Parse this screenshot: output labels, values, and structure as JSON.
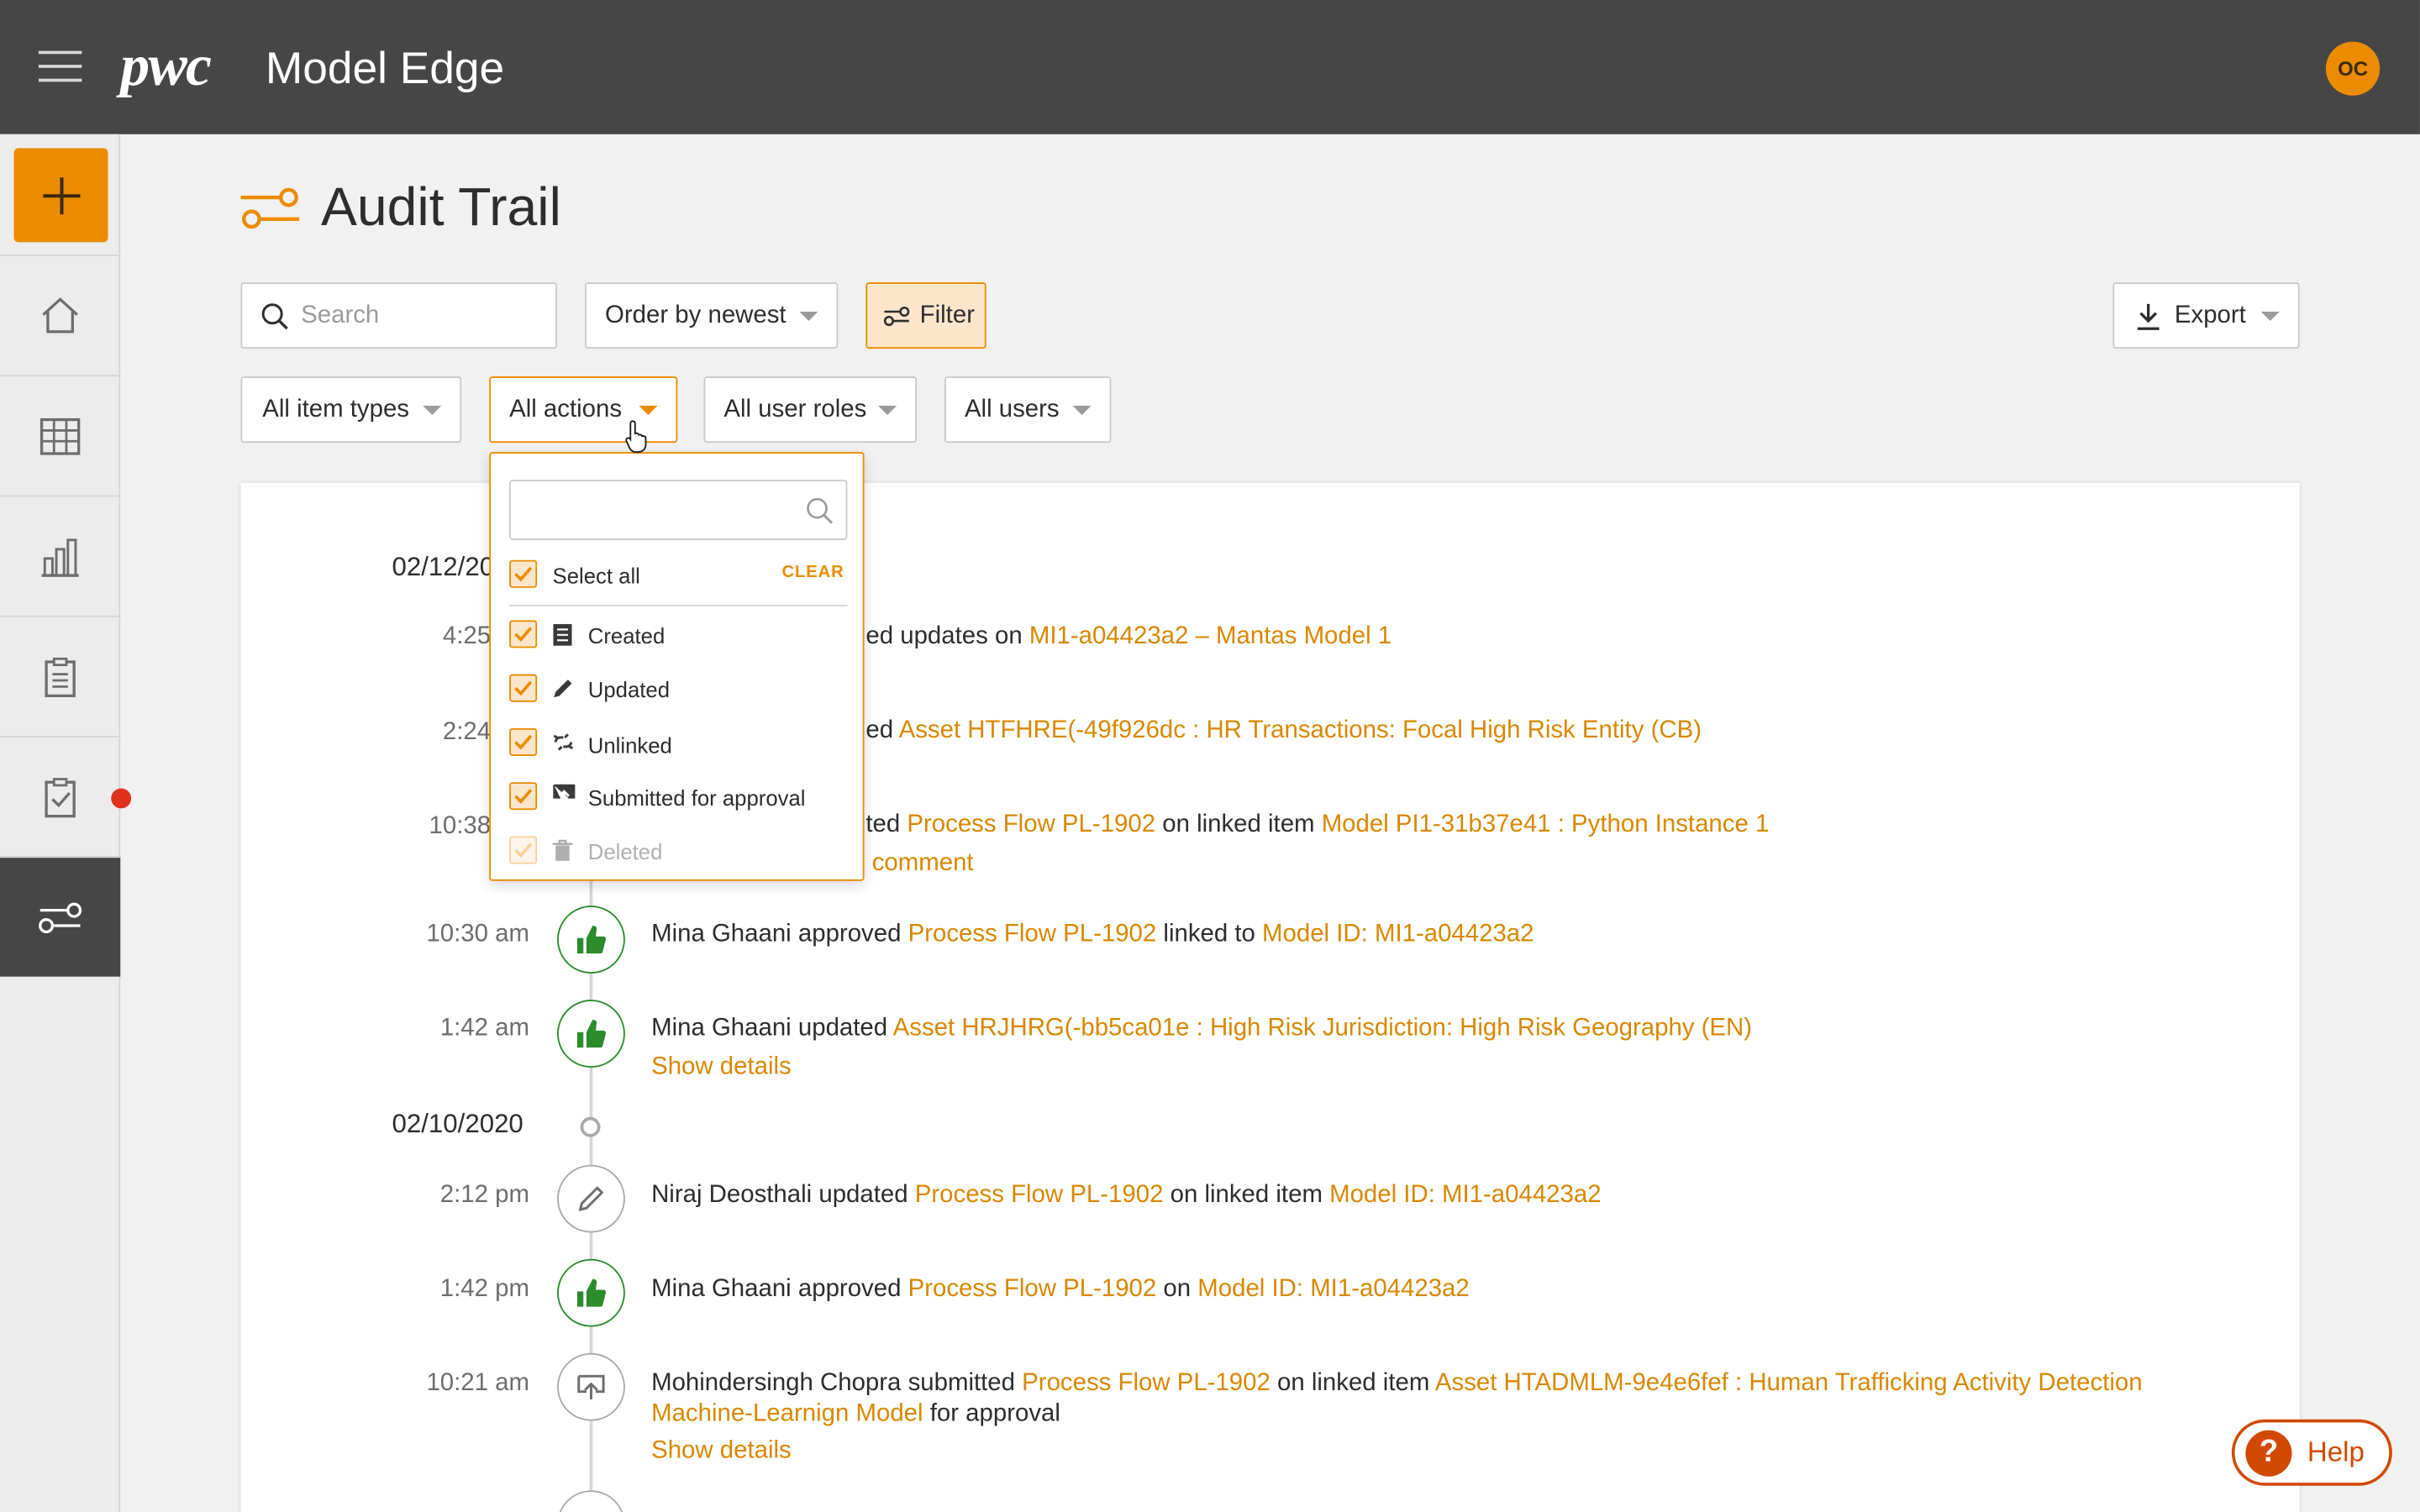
{
  "header": {
    "logo": "pwc",
    "product": "Model Edge",
    "avatar_initials": "OC"
  },
  "sidebar": {
    "items": [
      "add-icon",
      "home-icon",
      "table-icon",
      "bar-chart-icon",
      "clipboard-icon",
      "clipboard-check-icon",
      "audit-trail-icon"
    ]
  },
  "page": {
    "title": "Audit Trail"
  },
  "toolbar": {
    "search_placeholder": "Search",
    "order_label": "Order by newest",
    "filter_label": "Filter",
    "export_label": "Export"
  },
  "filters": {
    "item_types": "All item types",
    "actions": "All actions",
    "user_roles": "All user roles",
    "users": "All users"
  },
  "actions_dropdown": {
    "select_all": "Select all",
    "clear": "CLEAR",
    "options": [
      "Created",
      "Updated",
      "Unlinked",
      "Submitted for approval",
      "Deleted"
    ]
  },
  "timeline": {
    "groups": [
      {
        "date": "02/12/20",
        "entries": [
          {
            "time": "4:25",
            "text_parts": [
              "ed updates on ",
              "MI1-a04423a2 – Mantas Model 1"
            ]
          },
          {
            "time": "2:24",
            "text_parts": [
              "ed ",
              "Asset HTFHRE(-49f926dc : HR Transactions: Focal High Risk Entity (CB)"
            ]
          },
          {
            "time": "10:38",
            "text_parts": [
              "ted ",
              "Process Flow PL-1902",
              " on linked item ",
              "Model PI1-31b37e41 : Python Instance 1"
            ],
            "sub": "comment"
          },
          {
            "time": "10:30 am",
            "user": "Mina Ghaani",
            "verb": "approved",
            "text_parts": [
              "Process Flow PL-1902",
              " linked to ",
              "Model ID: MI1-a04423a2"
            ]
          },
          {
            "time": "1:42 am",
            "user": "Mina Ghaani",
            "verb": "updated",
            "text_parts": [
              "Asset HRJHRG(-bb5ca01e : High Risk Jurisdiction: High Risk Geography (EN)"
            ],
            "show_details": "Show details"
          }
        ]
      },
      {
        "date": "02/10/2020",
        "entries": [
          {
            "time": "2:12 pm",
            "user": "Niraj Deosthali",
            "verb": "updated",
            "text_parts": [
              "Process Flow PL-1902",
              " on linked item ",
              "Model ID: MI1-a04423a2"
            ]
          },
          {
            "time": "1:42 pm",
            "user": "Mina Ghaani",
            "verb": "approved",
            "text_parts": [
              "Process Flow PL-1902",
              " on ",
              "Model ID: MI1-a04423a2"
            ]
          },
          {
            "time": "10:21 am",
            "user": "Mohindersingh Chopra",
            "verb": "submitted",
            "text_parts": [
              "Process Flow PL-1902",
              " on linked item ",
              "Asset HTADMLM-9e4e6fef : Human Trafficking Activity Detection Machine-Learnign Model",
              " for approval"
            ],
            "show_details": "Show details"
          }
        ]
      }
    ]
  },
  "help": {
    "label": "Help",
    "glyph": "?"
  },
  "colors": {
    "accent": "#eb8c00",
    "topbar": "#464646",
    "approve_green": "#2c8c2c",
    "help_red": "#d04a02",
    "notification": "#e0301e"
  }
}
